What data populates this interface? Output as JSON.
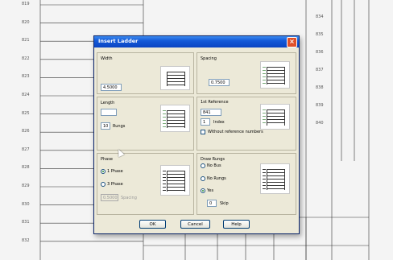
{
  "background": {
    "left_rows": [
      "819",
      "820",
      "821",
      "822",
      "823",
      "824",
      "825",
      "826",
      "827",
      "828",
      "829",
      "830",
      "831",
      "832"
    ],
    "right_rows": [
      "834",
      "835",
      "836",
      "837",
      "838",
      "839",
      "840"
    ]
  },
  "dialog": {
    "title": "Insert Ladder",
    "width": {
      "label": "Width",
      "value": "4.5000"
    },
    "spacing": {
      "label": "Spacing",
      "value": "0.7500"
    },
    "length": {
      "label": "Length",
      "value": "",
      "rungs_value": "10",
      "rungs_label": "Rungs"
    },
    "first_reference": {
      "label": "1st Reference",
      "value": "841",
      "index_value": "1",
      "index_label": "Index",
      "without_label": "Without reference numbers"
    },
    "phase": {
      "label": "Phase",
      "one_phase": "1 Phase",
      "three_phase": "3 Phase",
      "spacing_value": "0.5000",
      "spacing_label": "Spacing"
    },
    "draw_rungs": {
      "label": "Draw Rungs",
      "no_bus": "No Bus",
      "no_rungs": "No Rungs",
      "yes": "Yes",
      "skip_value": "0",
      "skip_label": "Skip"
    },
    "buttons": {
      "ok": "OK",
      "cancel": "Cancel",
      "help": "Help"
    }
  }
}
